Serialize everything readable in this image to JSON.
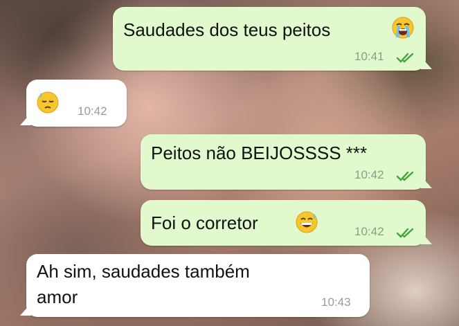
{
  "messages": [
    {
      "direction": "outgoing",
      "text": "Saudades dos teus peitos",
      "emoji": "loudly-crying-face",
      "time": "10:41",
      "status": "read"
    },
    {
      "direction": "incoming",
      "text": "",
      "emoji": "downcast-face-with-sweat",
      "time": "10:42"
    },
    {
      "direction": "outgoing",
      "text": "Peitos não BEIJOSSSS ***",
      "time": "10:42",
      "status": "read"
    },
    {
      "direction": "outgoing",
      "text": "Foi o corretor",
      "emoji": "grinning-face-with-sweat",
      "time": "10:42",
      "status": "read"
    },
    {
      "direction": "incoming",
      "text": "Ah sim, saudades também",
      "text_line2": "amor",
      "time": "10:43"
    }
  ],
  "colors": {
    "outgoing_bubble": "#e2f8cd",
    "incoming_bubble": "#ffffff",
    "read_check": "#3fa63c",
    "time_text": "#8e9c86"
  }
}
